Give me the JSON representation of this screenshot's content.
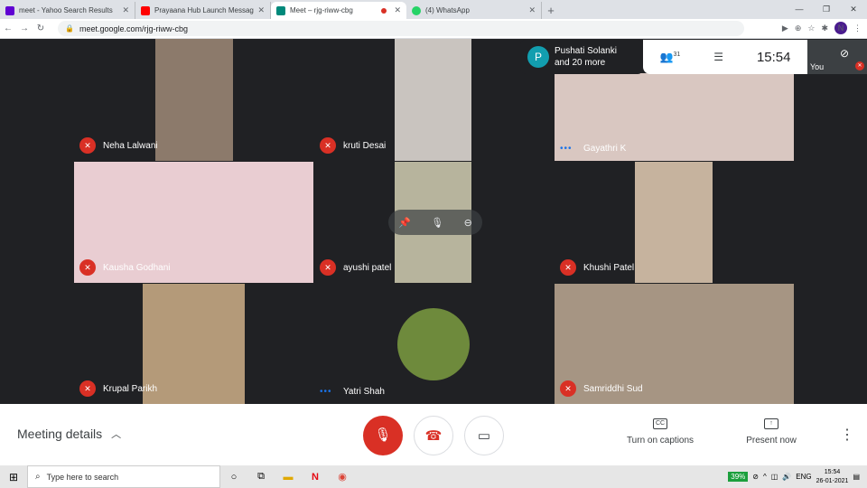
{
  "browser": {
    "tabs": [
      {
        "title": "meet - Yahoo Search Results",
        "color": "#6001d2",
        "active": false
      },
      {
        "title": "Prayaana Hub Launch Message i",
        "color": "#ff0000",
        "active": false
      },
      {
        "title": "Meet – rjg-riww-cbg",
        "color": "#00897b",
        "active": true
      },
      {
        "title": "(4) WhatsApp",
        "color": "#25d366",
        "active": false
      }
    ],
    "url": "meet.google.com/rjg-riww-cbg",
    "profile_initial": "N"
  },
  "meet": {
    "participants": [
      {
        "name": "Neha Lalwani",
        "mic": "muted",
        "bg": "#5f6368",
        "video": "#8c7a6b"
      },
      {
        "name": "kruti Desai",
        "mic": "muted",
        "bg": "#202124",
        "video": "#c9c4bf"
      },
      {
        "name": "Gayathri K",
        "mic": "speaking",
        "bg": "#202124",
        "video": "#d9c7c1"
      },
      {
        "name": "Kausha Godhani",
        "mic": "muted",
        "bg": "#e9cdd2",
        "video": "#e9cdd2"
      },
      {
        "name": "ayushi patel",
        "mic": "muted",
        "bg": "#202124",
        "video": "#b7b49d"
      },
      {
        "name": "Khushi Patel",
        "mic": "muted",
        "bg": "#202124",
        "video": "#c6b39e"
      },
      {
        "name": "Krupal Parikh",
        "mic": "muted",
        "bg": "#202124",
        "video": "#b49a79"
      },
      {
        "name": "Yatri Shah",
        "mic": "speaking",
        "bg": "#202124",
        "video": "#6e8a3c"
      },
      {
        "name": "Samriddhi Sud",
        "mic": "muted",
        "bg": "#202124",
        "video": "#a69583"
      }
    ],
    "notification": {
      "initial": "P",
      "line1": "Pushati Solanki",
      "line2": "and 20 more"
    },
    "people_count": "31",
    "time": "15:54",
    "self_label": "You"
  },
  "bottom": {
    "meeting_details": "Meeting details",
    "captions": "Turn on captions",
    "present": "Present now"
  },
  "taskbar": {
    "search_placeholder": "Type here to search",
    "battery": "39%",
    "lang": "ENG",
    "time": "15:54",
    "date": "26-01-2021"
  }
}
